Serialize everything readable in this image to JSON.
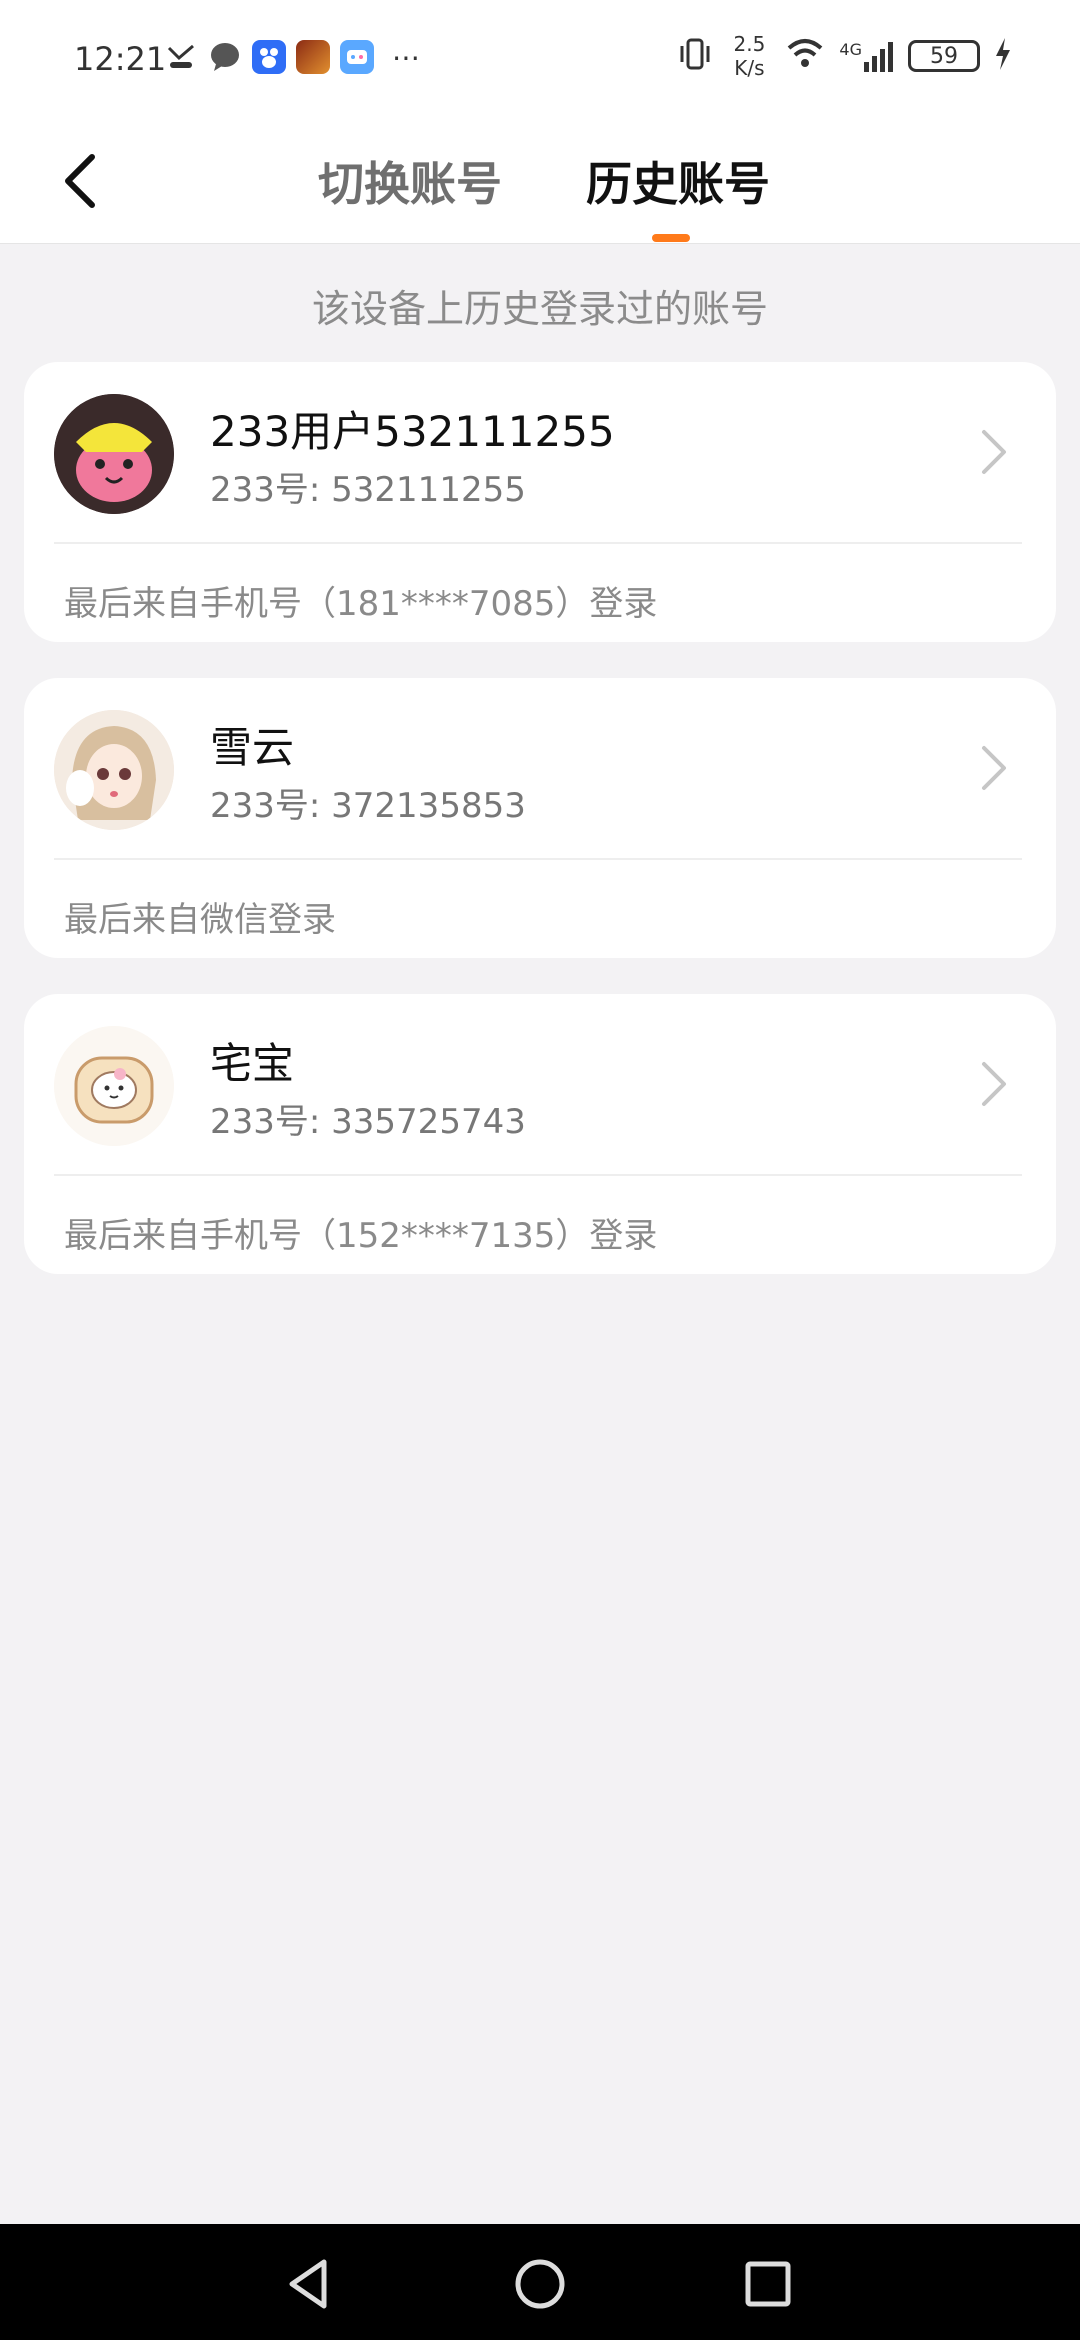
{
  "status_bar": {
    "time": "12:21",
    "net_speed_value": "2.5",
    "net_speed_unit": "K/s",
    "network": "4G",
    "battery": "59"
  },
  "header": {
    "tabs": [
      {
        "label": "切换账号",
        "active": false
      },
      {
        "label": "历史账号",
        "active": true
      }
    ],
    "accent_color": "#ff7a1a"
  },
  "subtitle": "该设备上历史登录过的账号",
  "accounts": [
    {
      "name": "233用户532111255",
      "uid": "233号: 532111255",
      "last_login": "最后来自手机号（181****7085）登录",
      "avatar_icon": "yellow-pink-character-avatar"
    },
    {
      "name": "雪云",
      "uid": "233号: 372135853",
      "last_login": "最后来自微信登录",
      "avatar_icon": "doll-avatar"
    },
    {
      "name": "宅宝",
      "uid": "233号: 335725743",
      "last_login": "最后来自手机号（152****7135）登录",
      "avatar_icon": "cat-toast-avatar"
    }
  ],
  "nav": {
    "back_icon": "triangle-back-icon",
    "home_icon": "circle-home-icon",
    "recents_icon": "square-recents-icon"
  }
}
